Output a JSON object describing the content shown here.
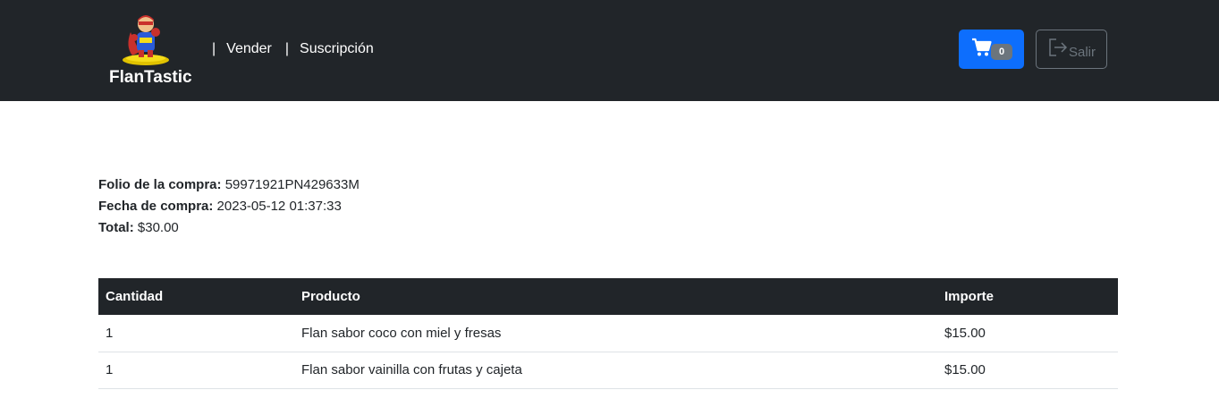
{
  "header": {
    "brand_name": "FlanTastic",
    "nav_separator": "|",
    "nav_links": [
      "Vender",
      "Suscripción"
    ],
    "cart": {
      "icon": "cart-icon",
      "count": "0"
    },
    "logout": {
      "icon": "logout-icon",
      "label": "Salir"
    },
    "colors": {
      "navbar": "#212529",
      "cart_button": "#0d6efd",
      "badge": "#6c757d"
    }
  },
  "purchase": {
    "folio_label": "Folio de la compra:",
    "folio_value": "59971921PN429633M",
    "date_label": "Fecha de compra:",
    "date_value": "2023-05-12 01:37:33",
    "total_label": "Total:",
    "total_value": "$30.00"
  },
  "table": {
    "headers": [
      "Cantidad",
      "Producto",
      "Importe"
    ],
    "rows": [
      [
        "1",
        "Flan sabor coco con miel y fresas",
        "$15.00"
      ],
      [
        "1",
        "Flan sabor vainilla con frutas y cajeta",
        "$15.00"
      ]
    ]
  }
}
